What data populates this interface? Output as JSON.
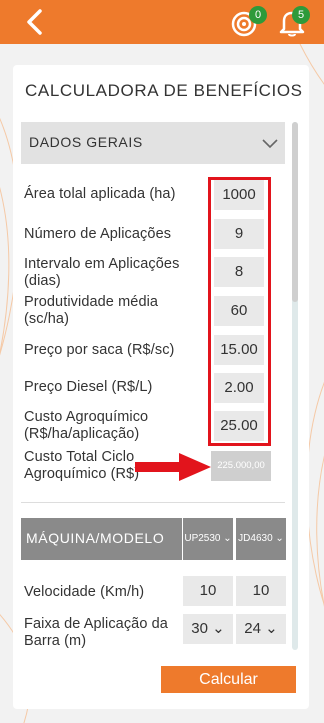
{
  "header": {
    "target_badge": "0",
    "bell_badge": "5"
  },
  "card": {
    "title": "CALCULADORA DE BENEFÍCIOS",
    "section_general": "DADOS GERAIS"
  },
  "fields": [
    {
      "label": "Área tolal aplicada (ha)",
      "value": "1000"
    },
    {
      "label": "Número de Aplicações",
      "value": "9"
    },
    {
      "label": "Intervalo em Aplicações (dias)",
      "value": "8"
    },
    {
      "label": "Produtividade média (sc/ha)",
      "value": "60"
    },
    {
      "label": "Preço por saca (R$/sc)",
      "value": "15.00"
    },
    {
      "label": "Preço Diesel (R$/L)",
      "value": "2.00"
    },
    {
      "label": "Custo Agroquímico (R$/ha/aplicação)",
      "value": "25.00"
    }
  ],
  "total": {
    "label": "Custo Total Ciclo Agroquímico (R$)",
    "value": "225.000,00"
  },
  "machine": {
    "label": "MÁQUINA/MODELO",
    "model1": "UP2530",
    "model2": "JD4630",
    "speed_label": "Velocidade (Km/h)",
    "speed1": "10",
    "speed2": "10",
    "width_label": "Faixa de Aplicação da Barra (m)",
    "width1": "30",
    "width2": "24"
  },
  "actions": {
    "calculate": "Calcular"
  },
  "colors": {
    "accent": "#ee7a2c",
    "highlight_red": "#e2141c",
    "badge_green": "#2e9a3a"
  }
}
